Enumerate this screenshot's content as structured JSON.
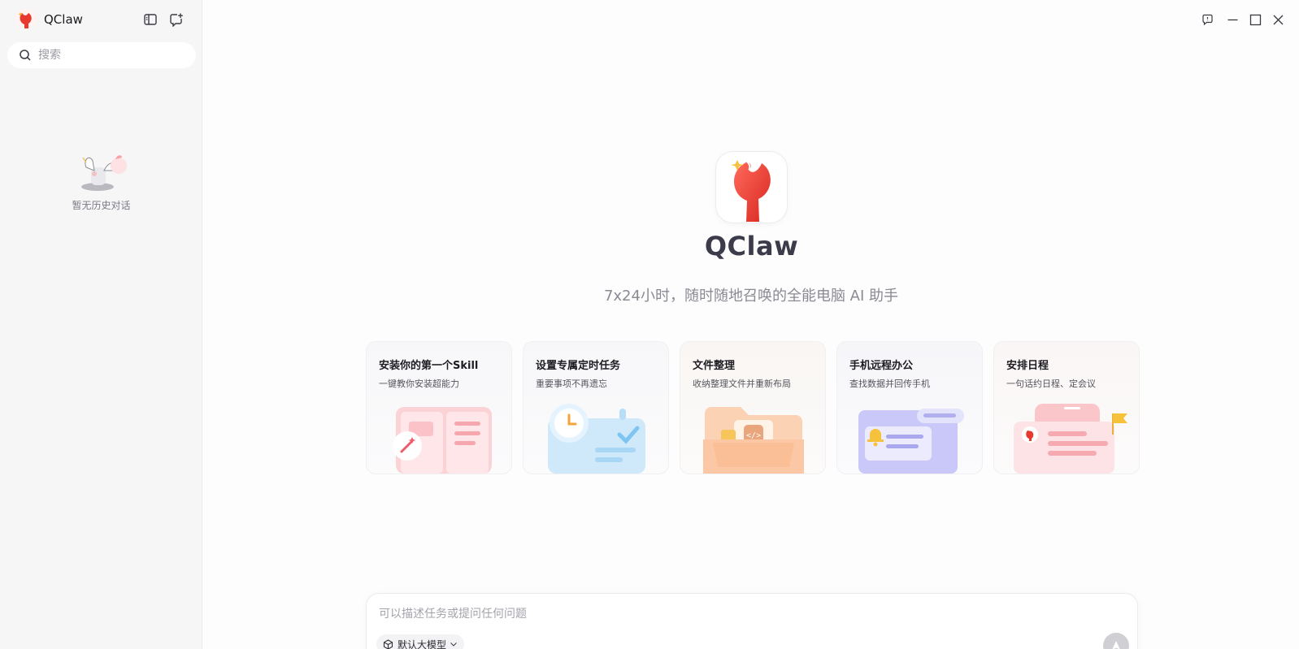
{
  "app": {
    "name": "QClaw"
  },
  "sidebar": {
    "search_placeholder": "搜索",
    "empty_text": "暂无历史对话",
    "toggle_icon": "sidebar-toggle-icon",
    "new_chat_icon": "new-chat-icon"
  },
  "window_controls": [
    "feedback-icon",
    "minimize-icon",
    "maximize-icon",
    "close-icon"
  ],
  "hero": {
    "title": "QClaw",
    "subtitle": "7x24小时，随时随地召唤的全能电脑 AI 助手"
  },
  "cards": [
    {
      "title": "安装你的第一个Skill",
      "desc": "一键教你安装超能力",
      "icon": "skill-book-illustration"
    },
    {
      "title": "设置专属定时任务",
      "desc": "重要事项不再遗忘",
      "icon": "clock-task-illustration"
    },
    {
      "title": "文件整理",
      "desc": "收纳整理文件并重新布局",
      "icon": "folder-illustration"
    },
    {
      "title": "手机远程办公",
      "desc": "查找数据并回传手机",
      "icon": "phone-remote-illustration"
    },
    {
      "title": "安排日程",
      "desc": "一句话约日程、定会议",
      "icon": "calendar-schedule-illustration"
    }
  ],
  "composer": {
    "placeholder": "可以描述任务或提问任何问题",
    "model_label": "默认大模型"
  },
  "colors": {
    "accent": "#e8392f",
    "background": "#fdfdfd",
    "sidebar": "#f6f6f7"
  }
}
